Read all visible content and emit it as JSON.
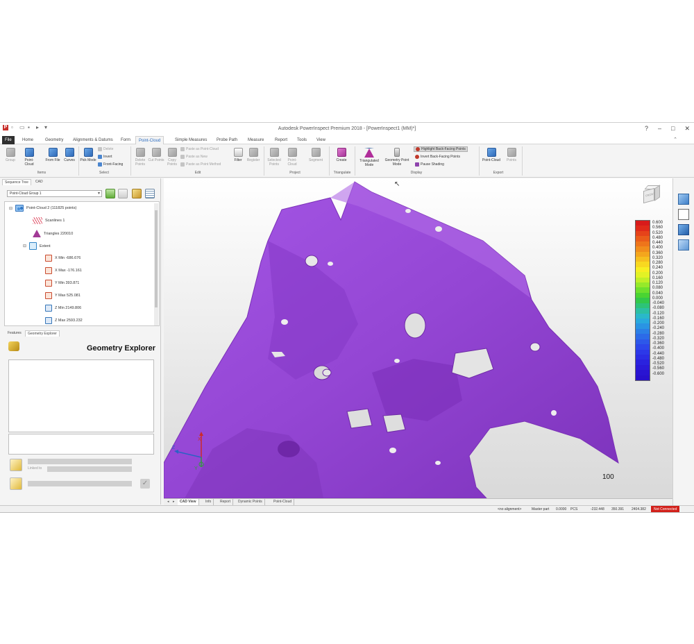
{
  "window": {
    "title": "Autodesk PowerInspect Premium 2018 - [PowerInspect1 (MM)*]",
    "help_glyph": "?",
    "minimize": "–",
    "restore": "□",
    "close": "✕"
  },
  "menu_tabs": [
    "File",
    "Home",
    "Geometry",
    "Alignments & Datums",
    "Form",
    "Point-Cloud",
    "Simple Measures",
    "Probe Path",
    "Measure",
    "Report",
    "Tools",
    "View"
  ],
  "active_tab": "Point-Cloud",
  "ribbon": {
    "items_group": {
      "label": "Items",
      "buttons": [
        "Group",
        "Point-Cloud",
        "From File",
        "Curves"
      ]
    },
    "select_group": {
      "label": "Select",
      "pick_mode": "Pick Mode",
      "small": [
        "Delete",
        "Invert",
        "Front-Facing"
      ]
    },
    "edit_group": {
      "label": "Edit",
      "buttons": [
        "Delete Points",
        "Cut Points",
        "Copy Points"
      ],
      "small": [
        "Paste as Point-Cloud",
        "Paste as New",
        "Paste as Point Method"
      ],
      "filter": "Filter",
      "register": "Register"
    },
    "project_group": {
      "label": "Project",
      "buttons": [
        "Selected Points",
        "Point-Cloud",
        "Segment"
      ]
    },
    "triangulate_group": {
      "label": "Triangulate",
      "create": "Create"
    },
    "display_group": {
      "label": "Display",
      "triangulated_mode": "Triangulated Mode",
      "geometry_point_mode": "Geometry Point Mode",
      "small": [
        "Highlight Back-Facing Points",
        "Invert Back-Facing Points",
        "Pause Shading"
      ]
    },
    "export_group": {
      "label": "Export",
      "buttons": [
        "Point-Cloud",
        "Points"
      ]
    }
  },
  "left_panel": {
    "tabs": [
      "Sequence Tree",
      "CAD"
    ],
    "group_select": "Point-Cloud Group 1",
    "tree": [
      {
        "label": "Point-Cloud 2 (111825 points)",
        "icon": "point-cloud-icon"
      },
      {
        "label": "Scanlines  1",
        "icon": "scanlines-icon"
      },
      {
        "label": "Triangles  220010",
        "icon": "triangles-icon"
      },
      {
        "label": "Extent",
        "icon": "extent-box-icon"
      },
      {
        "label": "X Min -686.676",
        "icon": "dimension-icon"
      },
      {
        "label": "X Max -176.161",
        "icon": "dimension-icon"
      },
      {
        "label": "Y Min 393.871",
        "icon": "dimension-icon"
      },
      {
        "label": "Y Max 525.081",
        "icon": "dimension-icon"
      },
      {
        "label": "Z Min 2149.806",
        "icon": "dimension-icon"
      },
      {
        "label": "Z Max 2593.232",
        "icon": "dimension-icon"
      }
    ],
    "lower_tabs": [
      "Features",
      "Geometry Explorer"
    ],
    "geometry_explorer_title": "Geometry Explorer",
    "linked_to_label": "Linked to"
  },
  "viewport": {
    "tabs": [
      "CAD View",
      "Info",
      "Report",
      "Dynamic Points",
      "Point-Cloud"
    ],
    "active": "CAD View",
    "scale_label": "100",
    "cube_label": "FRONT",
    "axis_labels": {
      "x": "X",
      "y": "Y",
      "z": "Z"
    },
    "pointer_glyph": "↖",
    "legend_values": [
      "0.600",
      "0.560",
      "0.520",
      "0.480",
      "0.440",
      "0.400",
      "0.360",
      "0.320",
      "0.280",
      "0.240",
      "0.200",
      "0.160",
      "0.120",
      "0.080",
      "0.040",
      "0.000",
      "-0.040",
      "-0.080",
      "-0.120",
      "-0.160",
      "-0.200",
      "-0.240",
      "-0.280",
      "-0.320",
      "-0.360",
      "-0.400",
      "-0.440",
      "-0.480",
      "-0.520",
      "-0.560",
      "-0.600"
    ],
    "legend_colors": [
      "#d81b1b",
      "#e02a1a",
      "#e6431a",
      "#ea5c1a",
      "#ee751b",
      "#f18d1c",
      "#f4a61d",
      "#f6bf1f",
      "#f8d820",
      "#f7ee22",
      "#e2f225",
      "#c0ef27",
      "#96e92a",
      "#6ee02d",
      "#4ad432",
      "#32c84a",
      "#2dc377",
      "#2cbfa3",
      "#2ab8c9",
      "#29a9dd",
      "#2a94e3",
      "#2b7fe6",
      "#2c6be8",
      "#2d58e9",
      "#2d47ea",
      "#2c38e8",
      "#2b2de4",
      "#2a22de",
      "#2a1ad8",
      "#2914d2",
      "#2810cc"
    ],
    "part_color": "#9b49d8"
  },
  "status_bar": {
    "alignment": "<no alignment>",
    "master_part": "Master part",
    "value": "0.0000",
    "pcs": "PCS",
    "x": "-232.448",
    "y": "350.391",
    "z": "2404.382",
    "connection": "Not Connected"
  }
}
